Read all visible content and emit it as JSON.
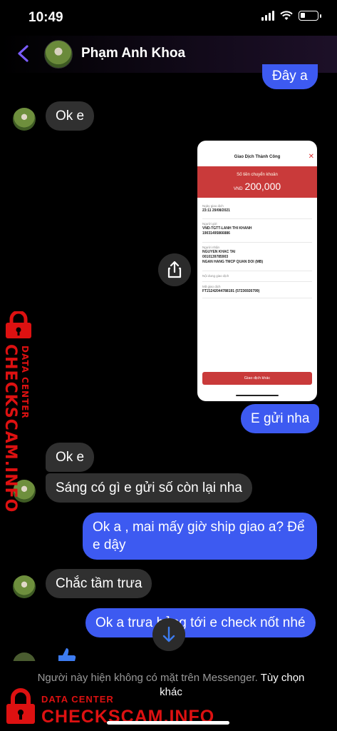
{
  "status": {
    "time": "10:49"
  },
  "header": {
    "contact_name": "Phạm Anh Khoa"
  },
  "messages": {
    "m1": "Đây a",
    "m2": "Ok e",
    "m3": "E gửi nha",
    "m4": "Ok e",
    "m5": "Sáng có gì e gửi số còn lại nha",
    "m6_line1": "Ok a , mai mấy giờ ship giao a? Để",
    "m6_line2": "e dậy",
    "m7": "Chắc tầm trưa",
    "m8": "Ok a trưa hỏng tới e check nốt nhé"
  },
  "receipt": {
    "title": "Giao Dịch Thành Công",
    "amount_label": "Số tiền chuyển khoản",
    "currency": "VND",
    "amount": "200,000",
    "date_label": "Ngày giao dịch",
    "date_value": "23:11 29/08/2021",
    "sender_label": "Người gửi",
    "sender_name": "VND-TGTT-LANH THI KHANH",
    "sender_account": "19031495866886",
    "receiver_label": "Người nhận",
    "receiver_name": "NGUYEN KHAC TAI",
    "receiver_account": "0010139785903",
    "receiver_bank": "NGAN HANG TMCP QUAN DOI (MB)",
    "content_label": "Nội dung giao dịch",
    "code_label": "Mã giao dịch",
    "code_value": "FT21242044788191 (57236926799)",
    "button": "Giao dịch khác"
  },
  "footer": {
    "notice": "Người này hiện không có mặt trên Messenger.",
    "link": "Tùy chọn khác"
  },
  "watermark": {
    "small": "DATA CENTER",
    "big": "CHECKSCAM.INFO"
  },
  "colors": {
    "outgoing_bubble": "#3d5af1",
    "incoming_bubble": "#303030",
    "accent": "#7b5cff",
    "watermark": "#dd1111"
  }
}
